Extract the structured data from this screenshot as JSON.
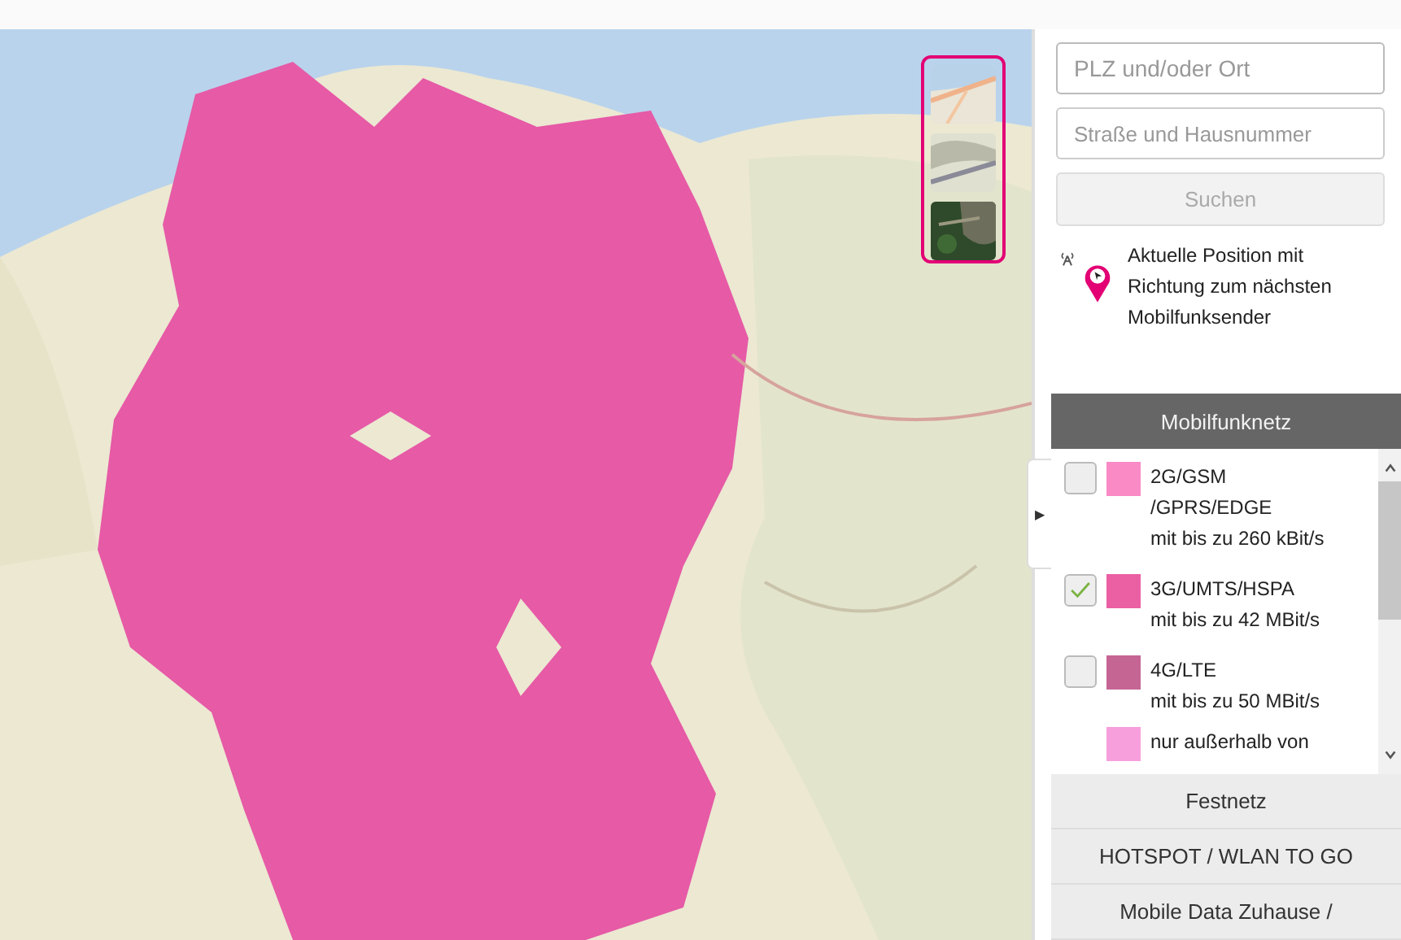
{
  "map": {
    "layers": [
      {
        "kind": "street",
        "selected": false
      },
      {
        "kind": "terrain",
        "selected": false
      },
      {
        "kind": "satellite",
        "selected": false
      }
    ]
  },
  "search": {
    "fields": [
      {
        "placeholder": "PLZ und/oder Ort"
      },
      {
        "placeholder": "Straße und Hausnummer"
      }
    ],
    "button": {
      "label": "Suchen",
      "disabled": true
    }
  },
  "locate": {
    "text": "Aktuelle Position mit Richtung zum nächsten Mobilfunksender"
  },
  "panel_toggle": "▶",
  "sections": [
    {
      "title": "Mobilfunknetz",
      "expanded": true
    },
    {
      "title": "Festnetz",
      "expanded": false
    },
    {
      "title": "HOTSPOT / WLAN TO GO",
      "expanded": false
    },
    {
      "title": "Mobile Data Zuhause /",
      "expanded": false
    }
  ],
  "legend": [
    {
      "kind": "check",
      "checked": false,
      "color": "#f98ac6",
      "name_lines": [
        "2G/GSM",
        "/GPRS/EDGE"
      ],
      "speed": "mit bis zu 260 kBit/s"
    },
    {
      "kind": "check",
      "checked": true,
      "color": "#eb5fa3",
      "name_lines": [
        "3G/UMTS/HSPA"
      ],
      "speed": "mit bis zu 42 MBit/s"
    },
    {
      "kind": "check",
      "checked": false,
      "color": "#c56593",
      "name_lines": [
        "4G/LTE"
      ],
      "speed": "mit bis zu 50 MBit/s"
    },
    {
      "kind": "note",
      "color": "#f79fdd",
      "name_lines": [
        "nur außerhalb von"
      ]
    }
  ]
}
